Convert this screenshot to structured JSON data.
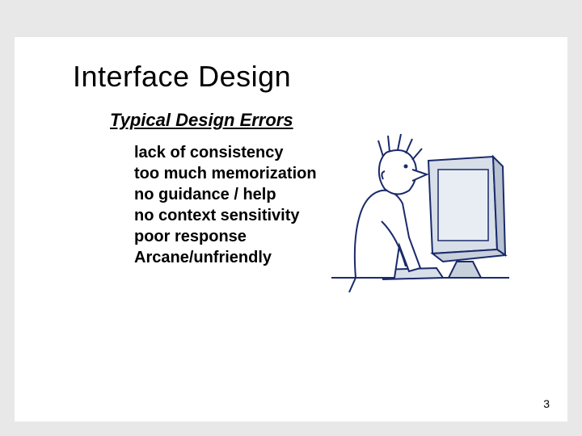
{
  "slide": {
    "title": "Interface Design",
    "subtitle": "Typical Design Errors",
    "errors": [
      "lack of consistency",
      "too much memorization",
      "no guidance / help",
      "no context sensitivity",
      "poor response",
      "Arcane/unfriendly"
    ],
    "page_number": "3",
    "illustration_alt": "person-at-computer-illustration"
  }
}
